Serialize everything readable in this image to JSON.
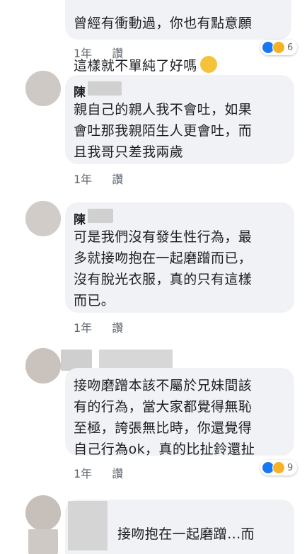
{
  "comments": [
    {
      "name": "",
      "text_line1": "曾經有衝動過，你也有點意願",
      "text_line2": "這樣就不單純了好嗎",
      "time": "1年",
      "reply": "讚",
      "react_count": "6"
    },
    {
      "name": "陳",
      "text": "親自己的親人我不會吐，如果\n會吐那我親陌生人更會吐，而\n且我哥只差我兩歲",
      "time": "1年",
      "reply": "讚"
    },
    {
      "name": "陳",
      "text": "可是我們沒有發生性行為，最\n多就接吻抱在一起磨蹭而已，\n沒有脫光衣服，真的只有這樣\n而已。",
      "time": "1年",
      "reply": "讚"
    },
    {
      "name": "",
      "text": "接吻磨蹭本該不屬於兄妹間該\n有的行為，當大家都覺得無恥\n至極，誇張無比時，你還覺得\n自己行為ok，真的比扯鈴還扯",
      "time": "1年",
      "reply": "讚",
      "react_count": "9"
    },
    {
      "name": "",
      "text": "接吻抱在一起磨蹭...而"
    }
  ],
  "colors": {
    "bubble": "#f0f2f5",
    "like": "#1877f2",
    "wow": "#f7b125"
  }
}
